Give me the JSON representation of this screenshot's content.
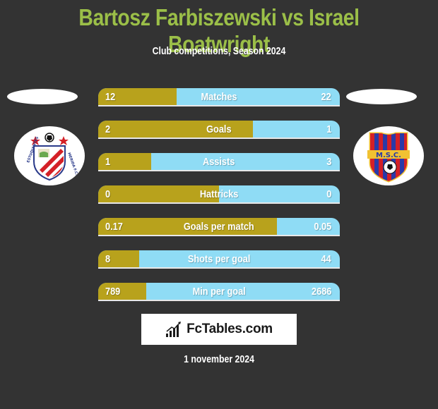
{
  "header": {
    "title": "Bartosz Farbiszewski vs Israel Boatwright",
    "subtitle": "Club competitions, Season 2024"
  },
  "teams": {
    "left": {
      "badge_icon": "estudiantes-de-merida-crest-icon",
      "badge_text": "ESTUDIANTES DE MERIDA F.C."
    },
    "right": {
      "badge_icon": "msc-crest-icon",
      "badge_text": "M.S.C."
    }
  },
  "colors": {
    "background": "#333333",
    "title": "#9bbf48",
    "left_bar": "#b8a21c",
    "right_bar": "#8fdcf5"
  },
  "stats": [
    {
      "label": "Matches",
      "left": "12",
      "right": "22",
      "left_share": 0.325
    },
    {
      "label": "Goals",
      "left": "2",
      "right": "1",
      "left_share": 0.64
    },
    {
      "label": "Assists",
      "left": "1",
      "right": "3",
      "left_share": 0.22
    },
    {
      "label": "Hattricks",
      "left": "0",
      "right": "0",
      "left_share": 0.5
    },
    {
      "label": "Goals per match",
      "left": "0.17",
      "right": "0.05",
      "left_share": 0.74
    },
    {
      "label": "Shots per goal",
      "left": "8",
      "right": "44",
      "left_share": 0.17
    },
    {
      "label": "Min per goal",
      "left": "789",
      "right": "2686",
      "left_share": 0.2
    }
  ],
  "footer": {
    "logo_text": "FcTables.com",
    "date": "1 november 2024"
  }
}
